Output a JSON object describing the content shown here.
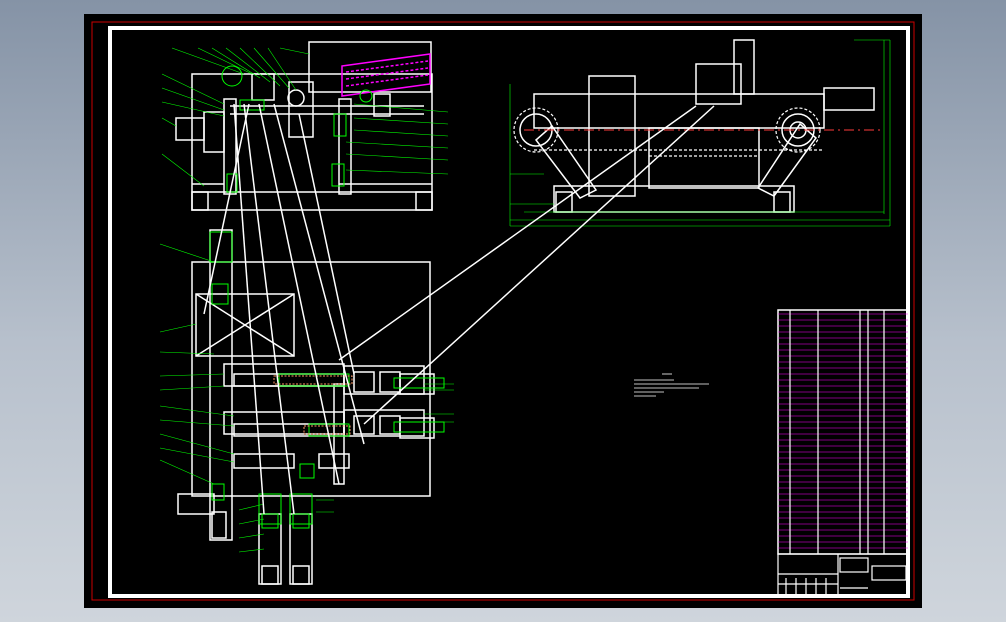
{
  "viewer": {
    "background_color": "#000000",
    "line_color": "#ffffff",
    "leader_color": "#00ff00",
    "table_color": "#ff00ff",
    "border_color": "#ff0000"
  },
  "drawing": {
    "title_block_label": "",
    "notes": ""
  }
}
